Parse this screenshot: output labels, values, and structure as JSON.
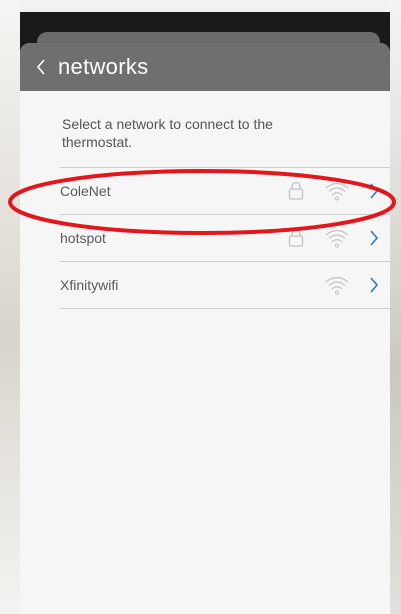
{
  "header": {
    "title": "networks",
    "back_icon": "chevron-left-icon"
  },
  "intro_text": "Select a network to connect to the thermostat.",
  "networks": [
    {
      "name": "ColeNet",
      "secured": true,
      "signal_icon": "wifi-icon"
    },
    {
      "name": "hotspot",
      "secured": true,
      "signal_icon": "wifi-icon"
    },
    {
      "name": "Xfinitywifi",
      "secured": false,
      "signal_icon": "wifi-icon"
    }
  ],
  "colors": {
    "header_bg": "#6f6f6f",
    "accent_chevron": "#2a7fc0",
    "highlight_annotation": "#e3171b",
    "icon_gray": "#c4c4c4"
  }
}
